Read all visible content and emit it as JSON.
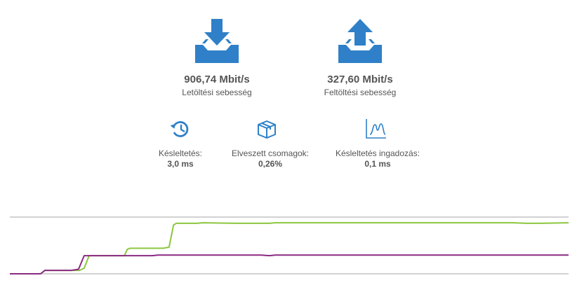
{
  "colors": {
    "icon_blue": "#2f80c8",
    "download_line": "#8cc63f",
    "upload_line": "#8a2a82",
    "grid_line": "#b8b8b8"
  },
  "download": {
    "icon": "download-tray-icon",
    "value": "906,74 Mbit/s",
    "label": "Letöltési sebesség"
  },
  "upload": {
    "icon": "upload-tray-icon",
    "value": "327,60 Mbit/s",
    "label": "Feltöltési sebesség"
  },
  "stats": {
    "latency": {
      "icon": "history-icon",
      "label": "Késleltetés:",
      "value": "3,0 ms"
    },
    "packet_loss": {
      "icon": "package-icon",
      "label": "Elveszett csomagok:",
      "value": "0,26%"
    },
    "jitter": {
      "icon": "distribution-chart-icon",
      "label": "Késleltetés ingadozás:",
      "value": "0,1 ms"
    }
  },
  "chart_data": {
    "type": "line",
    "title": "",
    "xlabel": "",
    "ylabel": "",
    "xlim": [
      0,
      100
    ],
    "ylim": [
      0,
      1000
    ],
    "grid": true,
    "series": [
      {
        "color": "#8cc63f",
        "x": [
          0,
          5.5,
          6.3,
          7.8,
          12.5,
          13.3,
          14.2,
          15.5,
          20.5,
          21.0,
          21.5,
          27.5,
          28.5,
          29.3,
          29.8,
          33.5,
          34.5,
          40.5,
          46.5,
          47.5,
          53.5,
          60,
          70,
          80,
          85,
          90,
          92.5,
          95,
          100
        ],
        "y": [
          0,
          0,
          60,
          60,
          60,
          100,
          320,
          320,
          320,
          430,
          450,
          450,
          470,
          860,
          890,
          890,
          900,
          890,
          890,
          900,
          900,
          900,
          900,
          900,
          900,
          900,
          890,
          890,
          900
        ]
      },
      {
        "color": "#8a2a82",
        "x": [
          0,
          5.5,
          6.3,
          11.0,
          12.3,
          13.3,
          14.5,
          20.5,
          25.5,
          26.5,
          35,
          45,
          46.5,
          47.5,
          55,
          65,
          72.5,
          73.5,
          80,
          90,
          100
        ],
        "y": [
          0,
          0,
          60,
          60,
          80,
          320,
          320,
          320,
          320,
          330,
          330,
          330,
          320,
          330,
          330,
          330,
          330,
          330,
          330,
          330,
          330
        ]
      }
    ]
  }
}
